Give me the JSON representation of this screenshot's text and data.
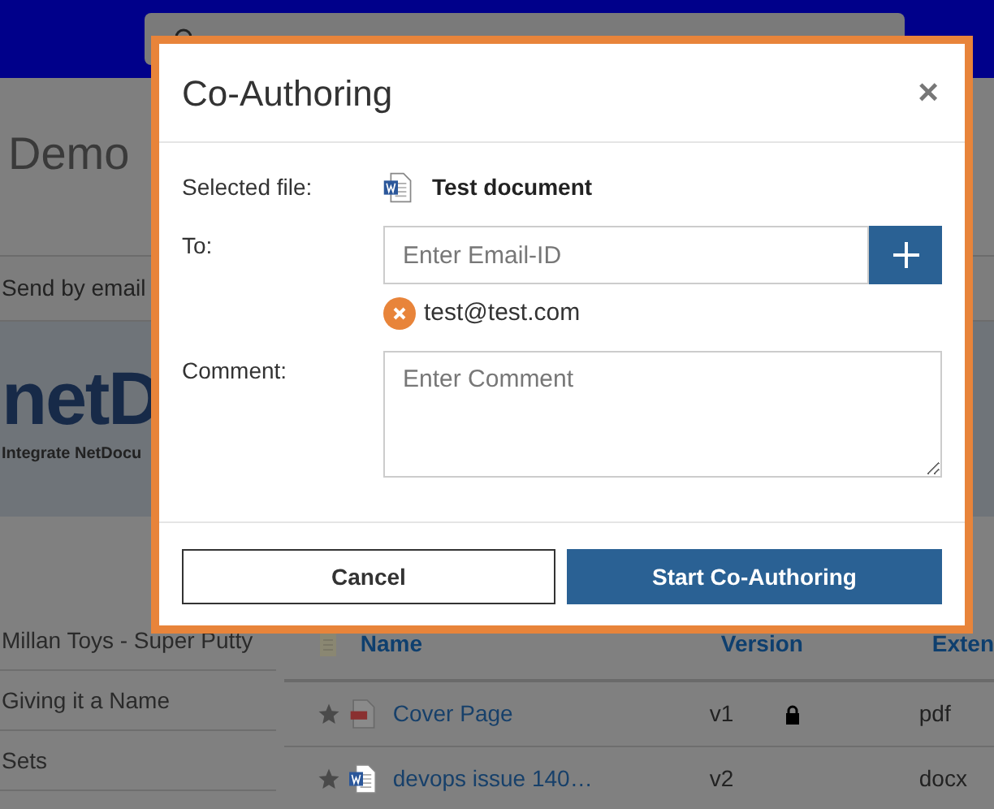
{
  "page": {
    "title": "Demo",
    "toolbar": [
      "Send by email"
    ],
    "banner": {
      "logo": "netD",
      "tagline": "Integrate NetDocu"
    }
  },
  "sidebar": {
    "items": [
      "Millan Toys - Super Putty",
      "Giving it a Name",
      "Sets"
    ]
  },
  "table": {
    "columns": [
      "Name",
      "Version",
      "Exten"
    ],
    "rows": [
      {
        "kind": "pdf",
        "name": "Cover Page",
        "version": "v1",
        "locked": true,
        "extension": "pdf"
      },
      {
        "kind": "word",
        "name": "devops issue 140…",
        "version": "v2",
        "locked": false,
        "extension": "docx"
      }
    ]
  },
  "dialog": {
    "title": "Co-Authoring",
    "close": "×",
    "selected_file_label": "Selected file:",
    "file_name": "Test document",
    "to_label": "To:",
    "email_placeholder": "Enter Email-ID",
    "recipients": [
      "test@test.com"
    ],
    "comment_label": "Comment:",
    "comment_placeholder": "Enter Comment",
    "buttons": [
      {
        "kind": "secondary",
        "label": "Cancel"
      },
      {
        "kind": "primary",
        "label": "Start Co-Authoring"
      }
    ]
  }
}
